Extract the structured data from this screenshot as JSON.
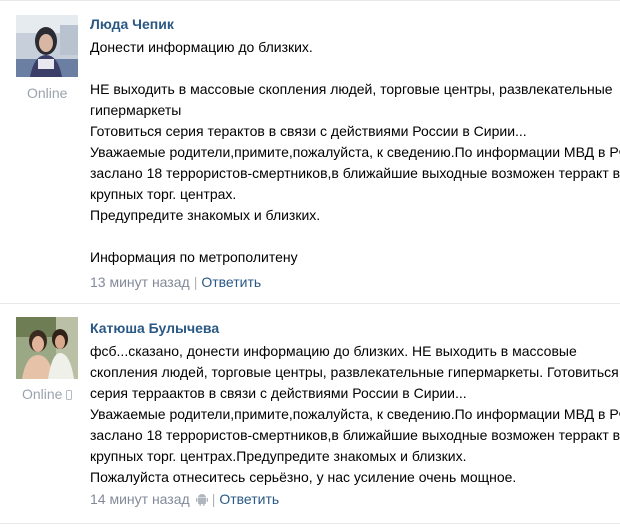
{
  "posts": [
    {
      "author": "Люда Чепик",
      "status": "Online",
      "lines": [
        "Донести информацию до близких.",
        "",
        "НЕ выходить в массовые скопления людей, торговые центры, развлекательные",
        "гипермаркеты",
        "Готовиться серия терактов в связи с действиями России в Сирии...",
        "Уважаемые родители,примите,пожалуйста, к сведению.По информации МВД в РФ",
        "заслано 18 террористов-смертников,в ближайшие выходные возможен терракт в",
        "крупных торг. центрах.",
        "Предупредите знакомых и близких.",
        "",
        "Информация по метрополитену"
      ],
      "time": "13 минут назад",
      "separator": "|",
      "reply": "Ответить"
    },
    {
      "author": "Катюша Булычева",
      "status": "Online",
      "lines": [
        "фсб...сказано, донести информацию до близких. НЕ выходить в массовые",
        "скопления людей, торговые центры, развлекательные гипермаркеты. Готовиться",
        "серия терраактов в связи с действиями России в Сирии...",
        "Уважаемые родители,примите,пожалуйста, к сведению.По информации МВД в РФ",
        "заслано 18 террористов-смертников,в ближайшие выходные возможен терракт в",
        "крупных торг. центрах.Предупредите знакомых и близких.",
        "Пожалуйста отнеситесь серьёзно, у нас усиление очень мощное."
      ],
      "time": "14 минут назад",
      "separator": "|",
      "reply": "Ответить"
    }
  ],
  "icons": {
    "device": "mobile-phone-icon",
    "platform": "android-icon"
  },
  "colors": {
    "author": "#2a5885",
    "meta": "#828a99",
    "online": "#9aa3ad",
    "divider": "#e7e8ec"
  }
}
